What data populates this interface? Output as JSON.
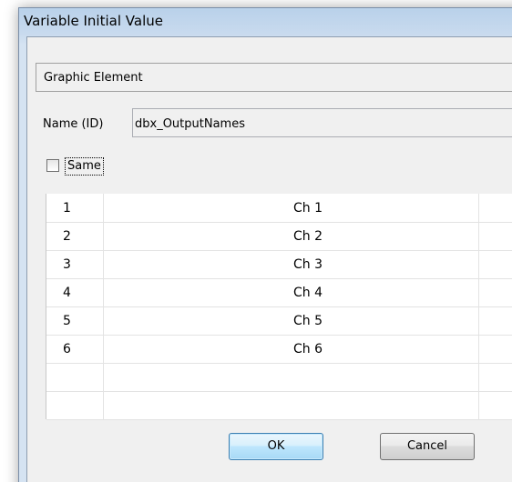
{
  "window": {
    "title": "Variable Initial Value"
  },
  "group": {
    "label": "Graphic Element"
  },
  "name_field": {
    "label": "Name (ID)",
    "value": "dbx_OutputNames"
  },
  "same_checkbox": {
    "label": "Same",
    "checked": false
  },
  "grid": {
    "rows": [
      {
        "index": "1",
        "value": "Ch 1"
      },
      {
        "index": "2",
        "value": "Ch 2"
      },
      {
        "index": "3",
        "value": "Ch 3"
      },
      {
        "index": "4",
        "value": "Ch 4"
      },
      {
        "index": "5",
        "value": "Ch 5"
      },
      {
        "index": "6",
        "value": "Ch 6"
      },
      {
        "index": "",
        "value": ""
      },
      {
        "index": "",
        "value": ""
      }
    ]
  },
  "buttons": {
    "ok": "OK",
    "cancel": "Cancel"
  }
}
